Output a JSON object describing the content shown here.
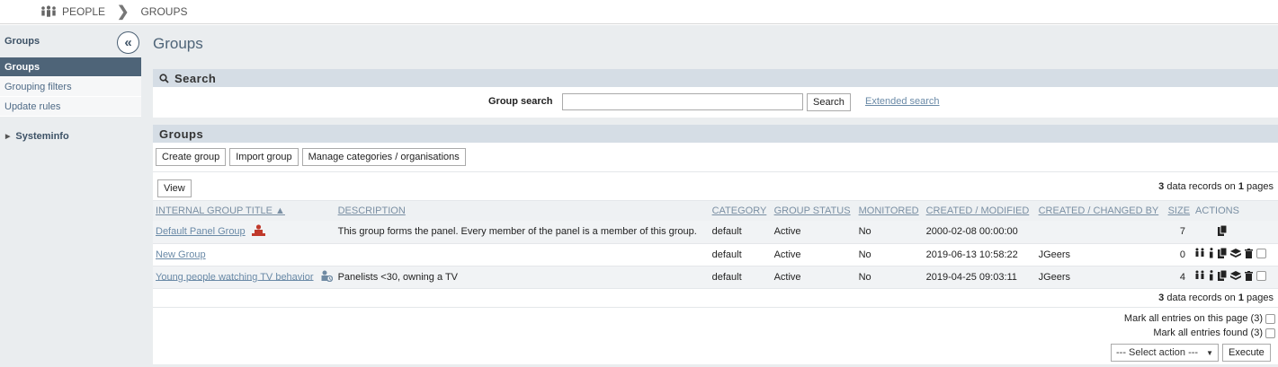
{
  "breadcrumb": {
    "root": "PEOPLE",
    "current": "GROUPS"
  },
  "sidebar": {
    "title": "Groups",
    "collapse_glyph": "«",
    "items": [
      {
        "label": "Groups",
        "active": true
      },
      {
        "label": "Grouping filters",
        "active": false
      },
      {
        "label": "Update rules",
        "active": false
      }
    ],
    "systeminfo": "Systeminfo"
  },
  "page_title": "Groups",
  "search": {
    "header": "Search",
    "label": "Group search",
    "value": "",
    "button": "Search",
    "extended_link": "Extended search"
  },
  "groups": {
    "header": "Groups",
    "buttons": {
      "create": "Create group",
      "import": "Import group",
      "manage": "Manage categories / organisations"
    },
    "view_button": "View",
    "records_top": {
      "count": "3",
      "mid": "data records on",
      "pages": "1",
      "end": "pages"
    },
    "records_bottom": {
      "count": "3",
      "mid": "data records on",
      "pages": "1",
      "end": "pages"
    },
    "columns": {
      "title": "INTERNAL GROUP TITLE ▲",
      "description": "DESCRIPTION",
      "category": "CATEGORY",
      "status": "GROUP STATUS",
      "monitored": "MONITORED",
      "created": "CREATED / MODIFIED",
      "changed_by": "CREATED / CHANGED BY",
      "size": "SIZE",
      "actions": "ACTIONS"
    },
    "rows": [
      {
        "title": "Default Panel Group",
        "description": "This group forms the panel. Every member of the panel is a member of this group.",
        "category": "default",
        "status": "Active",
        "monitored": "No",
        "created": "2000-02-08 00:00:00",
        "changed_by": "",
        "size": "7"
      },
      {
        "title": "New Group",
        "description": "",
        "category": "default",
        "status": "Active",
        "monitored": "No",
        "created": "2019-06-13 10:58:22",
        "changed_by": "JGeers",
        "size": "0"
      },
      {
        "title": "Young people watching TV behavior",
        "description": "Panelists <30, owning a TV",
        "category": "default",
        "status": "Active",
        "monitored": "No",
        "created": "2019-04-25 09:03:11",
        "changed_by": "JGeers",
        "size": "4"
      }
    ],
    "mark_page": "Mark all entries on this page (3)",
    "mark_all": "Mark all entries found (3)",
    "select_action": "--- Select action ---",
    "execute": "Execute"
  },
  "colors": {
    "sidebar_active": "#4e6478",
    "panel_head": "#d5dde5",
    "link": "#6a8aa7",
    "background": "#eaedef"
  }
}
